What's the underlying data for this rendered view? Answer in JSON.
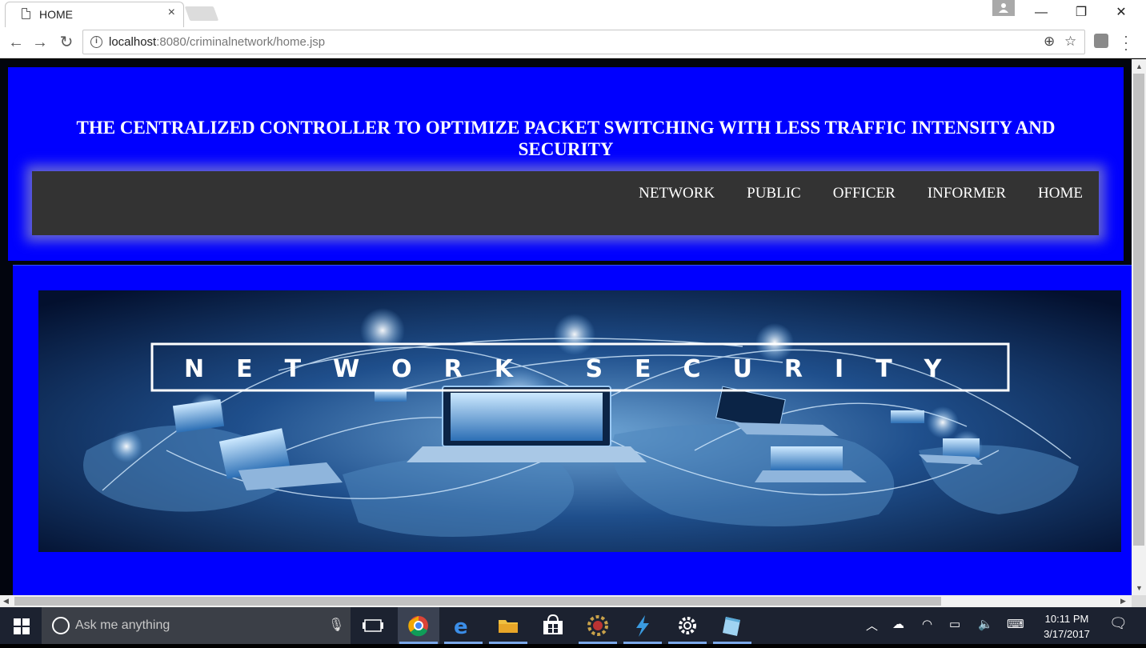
{
  "browser": {
    "tab_title": "HOME",
    "tab_close": "×",
    "url_host": "localhost",
    "url_rest": ":8080/criminalnetwork/home.jsp",
    "window_controls": {
      "minimize": "—",
      "restore": "❐",
      "close": "✕"
    }
  },
  "page": {
    "title": "THE CENTRALIZED CONTROLLER TO OPTIMIZE PACKET SWITCHING WITH LESS TRAFFIC INTENSITY AND SECURITY",
    "nav": [
      "NETWORK",
      "PUBLIC",
      "OFFICER",
      "INFORMER",
      "HOME"
    ],
    "banner_text": "NETWORK SECURITY",
    "colors": {
      "panel": "#0000ff",
      "navbar": "#333333",
      "background": "#02050e"
    }
  },
  "taskbar": {
    "search_placeholder": "Ask me anything",
    "time": "10:11 PM",
    "date": "3/17/2017",
    "icons": [
      "task-view-icon",
      "chrome-icon",
      "edge-icon",
      "file-explorer-icon",
      "store-icon",
      "app-gear-icon",
      "lightning-icon",
      "settings-icon",
      "notepad-icon"
    ]
  }
}
